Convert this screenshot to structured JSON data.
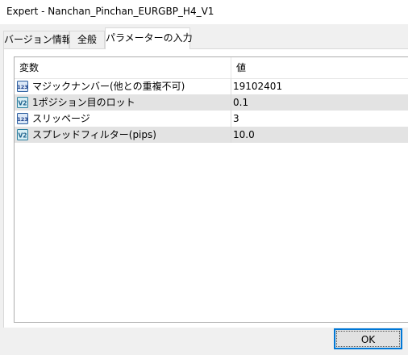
{
  "window": {
    "title": "Expert - Nanchan_Pinchan_EURGBP_H4_V1"
  },
  "tabs": [
    {
      "label": "バージョン情報"
    },
    {
      "label": "全般"
    },
    {
      "label": "パラメーターの入力",
      "active": true
    }
  ],
  "grid": {
    "headers": {
      "name": "変数",
      "value": "値"
    },
    "rows": [
      {
        "icon": "integer-param-icon",
        "icon_text": "123",
        "name": "マジックナンバー(他との重複不可)",
        "value": "19102401"
      },
      {
        "icon": "double-param-icon",
        "icon_text": "V2",
        "name": "1ポジション目のロット",
        "value": "0.1"
      },
      {
        "icon": "integer-param-icon",
        "icon_text": "123",
        "name": "スリッページ",
        "value": "3"
      },
      {
        "icon": "double-param-icon",
        "icon_text": "V2",
        "name": "スプレッドフィルター(pips)",
        "value": "10.0"
      }
    ]
  },
  "footer": {
    "ok_label": "OK"
  },
  "colors": {
    "accent": "#0078d7",
    "alt_row": "#e3e3e3",
    "window_bg": "#f0f0f0"
  }
}
